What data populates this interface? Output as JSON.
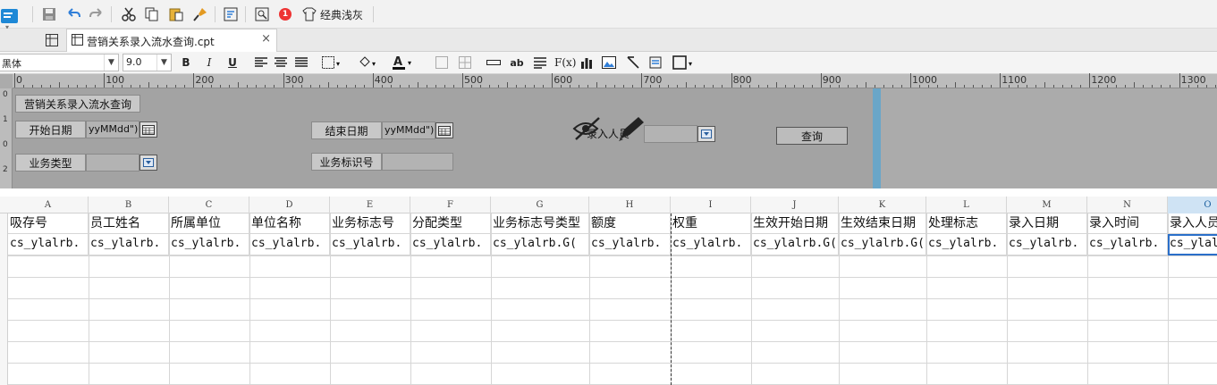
{
  "toolbar": {
    "theme_label": "经典浅灰",
    "notification_count": "1",
    "icons": [
      "save-icon",
      "undo-icon",
      "redo-icon",
      "cut-icon",
      "copy-icon",
      "paste-icon",
      "format-brush-icon",
      "template-icon",
      "preview-icon",
      "theme-icon"
    ]
  },
  "tab": {
    "label": "营销关系录入流水查询.cpt",
    "close": "×"
  },
  "format": {
    "font_name": "黑体",
    "font_size": "9.0",
    "bold": "B",
    "italic": "I",
    "underline": "U",
    "text_style": "ab",
    "formula": "F(x)"
  },
  "ruler": {
    "marks": [
      "0",
      "100",
      "200",
      "300",
      "400",
      "500",
      "600",
      "700",
      "800",
      "900",
      "1000",
      "1100",
      "1200",
      "1300"
    ],
    "vmarks": [
      "0",
      "1",
      "0",
      "2"
    ]
  },
  "param_panel": {
    "title_label": "营销关系录入流水查询",
    "start_date_label": "开始日期",
    "start_date_value": "yyMMdd\")",
    "end_date_label": "结束日期",
    "end_date_value": "yyMMdd\")",
    "entry_person_label": "录入人员",
    "business_type_label": "业务类型",
    "business_id_label": "业务标识号",
    "query_button": "查询"
  },
  "grid": {
    "columns": [
      "A",
      "B",
      "C",
      "D",
      "E",
      "F",
      "G",
      "H",
      "I",
      "J",
      "K",
      "L",
      "M",
      "N",
      "O"
    ],
    "selected_column": "O",
    "headers": [
      "吸存号",
      "员工姓名",
      "所属单位",
      "单位名称",
      "业务标志号",
      "分配类型",
      "业务标志号类型",
      "额度",
      "权重",
      "生效开始日期",
      "生效结束日期",
      "处理标志",
      "录入日期",
      "录入时间",
      "录入人员"
    ],
    "values": [
      "cs_ylalrb.",
      "cs_ylalrb.",
      "cs_ylalrb.",
      "cs_ylalrb.",
      "cs_ylalrb.",
      "cs_ylalrb.",
      "cs_ylalrb.G(",
      "cs_ylalrb.",
      "cs_ylalrb.",
      "cs_ylalrb.G(",
      "cs_ylalrb.G(",
      "cs_ylalrb.",
      "cs_ylalrb.",
      "cs_ylalrb.",
      "cs_ylal"
    ]
  },
  "colors": {
    "accent": "#2a6fc9",
    "panel_bg": "#a3a3a3",
    "panel_edge": "#6aa6c8"
  }
}
